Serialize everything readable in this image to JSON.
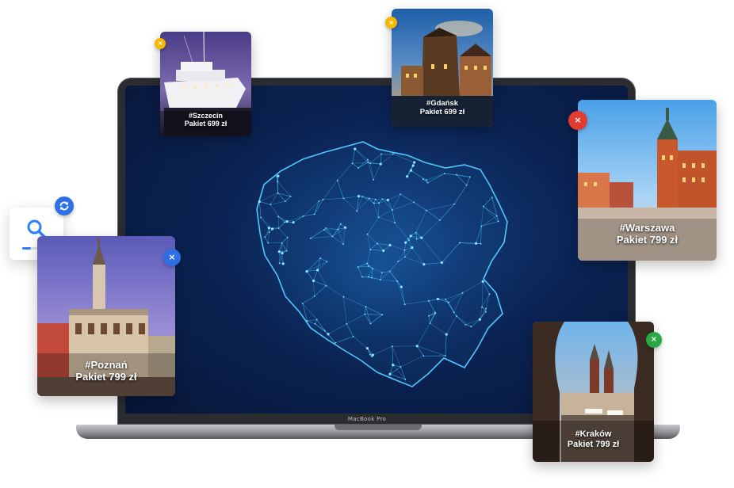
{
  "laptop": {
    "brand_label": "MacBook Pro"
  },
  "search_widget": {
    "icon": "search-icon",
    "refresh_icon": "refresh-icon",
    "progress": 0.3
  },
  "colors": {
    "blue": "#2f6ee5",
    "yellow": "#f5b800",
    "red": "#e23b30",
    "green": "#2aa845"
  },
  "cards": {
    "szczecin": {
      "tag": "#Szczecin",
      "price": "Pakiet 699 zł",
      "close_icon": "close-icon"
    },
    "gdansk": {
      "tag": "#Gdańsk",
      "price": "Pakiet 699 zł",
      "close_icon": "close-icon"
    },
    "warszawa": {
      "tag": "#Warszawa",
      "price": "Pakiet 799 zł",
      "close_icon": "close-icon"
    },
    "poznan": {
      "tag": "#Poznań",
      "price": "Pakiet 799 zł",
      "close_icon": "close-icon"
    },
    "krakow": {
      "tag": "#Kraków",
      "price": "Pakiet 799 zł",
      "close_icon": "close-icon"
    }
  }
}
